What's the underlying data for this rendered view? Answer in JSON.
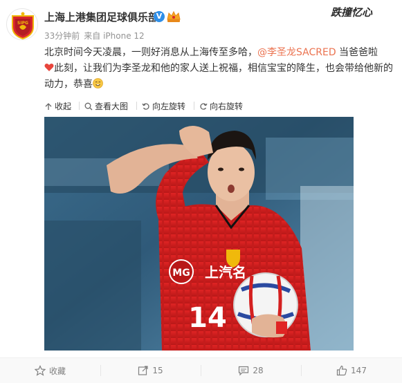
{
  "post": {
    "username": "上海上港集团足球俱乐部",
    "verified_badge": "V",
    "time": "33分钟前",
    "source": "来自 iPhone 12",
    "brand_logo_text": "跌撞忆心",
    "text_part1": "北京时间今天凌晨，一则好消息从上海传至多哈，",
    "mention": "@李圣龙SACRED",
    "text_part2": " 当爸爸啦",
    "text_part3": "此刻，让我们为李圣龙和他的家人送上祝福，相信宝宝的降生，也会带给他新的动力，恭喜",
    "avatar_text": "SIPG"
  },
  "image_toolbar": {
    "collapse": "收起",
    "view_large": "查看大图",
    "rotate_left": "向左旋转",
    "rotate_right": "向右旋转"
  },
  "photo": {
    "jersey_number": "14",
    "jersey_sponsor": "上汽名",
    "mg_logo": "MG"
  },
  "actions": {
    "favorite": "收藏",
    "repost_count": "15",
    "comment_count": "28",
    "like_count": "147"
  },
  "colors": {
    "mention": "#eb7350",
    "verified": "#2f8fe8",
    "jersey_red": "#d42020"
  }
}
